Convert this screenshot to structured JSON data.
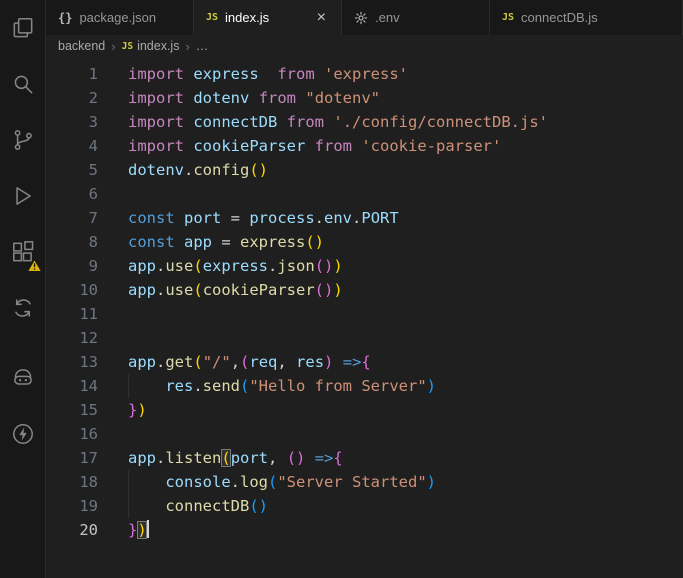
{
  "colors": {
    "activity_bar_bg": "#181818",
    "tab_bar_bg": "#181818",
    "editor_bg": "#1f1f1f",
    "icon_fg": "#868686",
    "warning_badge": "#ddb100",
    "tokens": {
      "kw": "#C586C0",
      "storage": "#569CD6",
      "var": "#9CDCFE",
      "fn": "#DCDCAA",
      "str": "#CE9178",
      "pun": "#D4D4D4",
      "b1": "#FFD700",
      "b2": "#DA70D6",
      "b3": "#179FFF"
    }
  },
  "activity_bar": {
    "items": [
      {
        "name": "explorer"
      },
      {
        "name": "search"
      },
      {
        "name": "source-control"
      },
      {
        "name": "run-debug"
      },
      {
        "name": "extensions",
        "badge": "warning"
      },
      {
        "name": "sync"
      },
      {
        "name": "copilot"
      },
      {
        "name": "thunder-client"
      }
    ]
  },
  "tabs": [
    {
      "id": "package-json",
      "icon": "braces",
      "icon_glyph": "{}",
      "icon_color": "#b8b8b8",
      "label": "package.json",
      "active": false
    },
    {
      "id": "index-js",
      "icon": "js",
      "icon_glyph": "JS",
      "icon_color": "#cbcb41",
      "label": "index.js",
      "active": true,
      "close_label": "×"
    },
    {
      "id": "env",
      "icon": "gear",
      "icon_glyph": "",
      "icon_color": "#c5c5c5",
      "label": ".env",
      "active": false
    },
    {
      "id": "connectdb-js",
      "icon": "js",
      "icon_glyph": "JS",
      "icon_color": "#cbcb41",
      "label": "connectDB.js",
      "active": false
    }
  ],
  "breadcrumb": {
    "folder": "backend",
    "separator": "›",
    "file_icon": "JS",
    "file": "index.js",
    "more": "…"
  },
  "editor": {
    "active_line": 20,
    "lines": [
      {
        "n": 1,
        "tokens": [
          [
            "kw",
            "import"
          ],
          [
            "pun",
            " "
          ],
          [
            "var",
            "express"
          ],
          [
            "pun",
            "  "
          ],
          [
            "kw",
            "from"
          ],
          [
            "pun",
            " "
          ],
          [
            "str",
            "'express'"
          ]
        ]
      },
      {
        "n": 2,
        "tokens": [
          [
            "kw",
            "import"
          ],
          [
            "pun",
            " "
          ],
          [
            "var",
            "dotenv"
          ],
          [
            "pun",
            " "
          ],
          [
            "kw",
            "from"
          ],
          [
            "pun",
            " "
          ],
          [
            "str",
            "\"dotenv\""
          ]
        ]
      },
      {
        "n": 3,
        "tokens": [
          [
            "kw",
            "import"
          ],
          [
            "pun",
            " "
          ],
          [
            "var",
            "connectDB"
          ],
          [
            "pun",
            " "
          ],
          [
            "kw",
            "from"
          ],
          [
            "pun",
            " "
          ],
          [
            "str",
            "'./config/connectDB.js'"
          ]
        ]
      },
      {
        "n": 4,
        "tokens": [
          [
            "kw",
            "import"
          ],
          [
            "pun",
            " "
          ],
          [
            "var",
            "cookieParser"
          ],
          [
            "pun",
            " "
          ],
          [
            "kw",
            "from"
          ],
          [
            "pun",
            " "
          ],
          [
            "str",
            "'cookie-parser'"
          ]
        ]
      },
      {
        "n": 5,
        "tokens": [
          [
            "var",
            "dotenv"
          ],
          [
            "pun",
            "."
          ],
          [
            "fn",
            "config"
          ],
          [
            "b1",
            "()"
          ]
        ]
      },
      {
        "n": 6,
        "tokens": []
      },
      {
        "n": 7,
        "tokens": [
          [
            "storage",
            "const"
          ],
          [
            "pun",
            " "
          ],
          [
            "var",
            "port"
          ],
          [
            "pun",
            " = "
          ],
          [
            "var",
            "process"
          ],
          [
            "pun",
            "."
          ],
          [
            "var",
            "env"
          ],
          [
            "pun",
            "."
          ],
          [
            "var",
            "PORT"
          ]
        ]
      },
      {
        "n": 8,
        "tokens": [
          [
            "storage",
            "const"
          ],
          [
            "pun",
            " "
          ],
          [
            "var",
            "app"
          ],
          [
            "pun",
            " = "
          ],
          [
            "fn",
            "express"
          ],
          [
            "b1",
            "()"
          ]
        ]
      },
      {
        "n": 9,
        "tokens": [
          [
            "var",
            "app"
          ],
          [
            "pun",
            "."
          ],
          [
            "fn",
            "use"
          ],
          [
            "b1",
            "("
          ],
          [
            "var",
            "express"
          ],
          [
            "pun",
            "."
          ],
          [
            "fn",
            "json"
          ],
          [
            "b2",
            "()"
          ],
          [
            "b1",
            ")"
          ]
        ]
      },
      {
        "n": 10,
        "tokens": [
          [
            "var",
            "app"
          ],
          [
            "pun",
            "."
          ],
          [
            "fn",
            "use"
          ],
          [
            "b1",
            "("
          ],
          [
            "fn",
            "cookieParser"
          ],
          [
            "b2",
            "()"
          ],
          [
            "b1",
            ")"
          ]
        ]
      },
      {
        "n": 11,
        "tokens": []
      },
      {
        "n": 12,
        "tokens": []
      },
      {
        "n": 13,
        "tokens": [
          [
            "var",
            "app"
          ],
          [
            "pun",
            "."
          ],
          [
            "fn",
            "get"
          ],
          [
            "b1",
            "("
          ],
          [
            "str",
            "\"/\""
          ],
          [
            "pun",
            ","
          ],
          [
            "b2",
            "("
          ],
          [
            "var",
            "req"
          ],
          [
            "pun",
            ", "
          ],
          [
            "var",
            "res"
          ],
          [
            "b2",
            ")"
          ],
          [
            "pun",
            " "
          ],
          [
            "storage",
            "=>"
          ],
          [
            "b2",
            "{"
          ]
        ]
      },
      {
        "n": 14,
        "guide": true,
        "tokens": [
          [
            "pun",
            "    "
          ],
          [
            "var",
            "res"
          ],
          [
            "pun",
            "."
          ],
          [
            "fn",
            "send"
          ],
          [
            "b3",
            "("
          ],
          [
            "str",
            "\"Hello from Server\""
          ],
          [
            "b3",
            ")"
          ]
        ]
      },
      {
        "n": 15,
        "tokens": [
          [
            "b2",
            "}"
          ],
          [
            "b1",
            ")"
          ]
        ]
      },
      {
        "n": 16,
        "tokens": []
      },
      {
        "n": 17,
        "tokens": [
          [
            "var",
            "app"
          ],
          [
            "pun",
            "."
          ],
          [
            "fn",
            "listen"
          ],
          [
            "b1",
            "(",
            "match"
          ],
          [
            "var",
            "port"
          ],
          [
            "pun",
            ", "
          ],
          [
            "b2",
            "()"
          ],
          [
            "pun",
            " "
          ],
          [
            "storage",
            "=>"
          ],
          [
            "b2",
            "{"
          ]
        ]
      },
      {
        "n": 18,
        "guide": true,
        "tokens": [
          [
            "pun",
            "    "
          ],
          [
            "var",
            "console"
          ],
          [
            "pun",
            "."
          ],
          [
            "fn",
            "log"
          ],
          [
            "b3",
            "("
          ],
          [
            "str",
            "\"Server Started\""
          ],
          [
            "b3",
            ")"
          ]
        ]
      },
      {
        "n": 19,
        "guide": true,
        "tokens": [
          [
            "pun",
            "    "
          ],
          [
            "fn",
            "connectDB"
          ],
          [
            "b3",
            "()"
          ]
        ]
      },
      {
        "n": 20,
        "tokens": [
          [
            "b2",
            "}"
          ],
          [
            "b1",
            ")",
            "match"
          ],
          [
            "cursor",
            ""
          ]
        ]
      }
    ]
  }
}
